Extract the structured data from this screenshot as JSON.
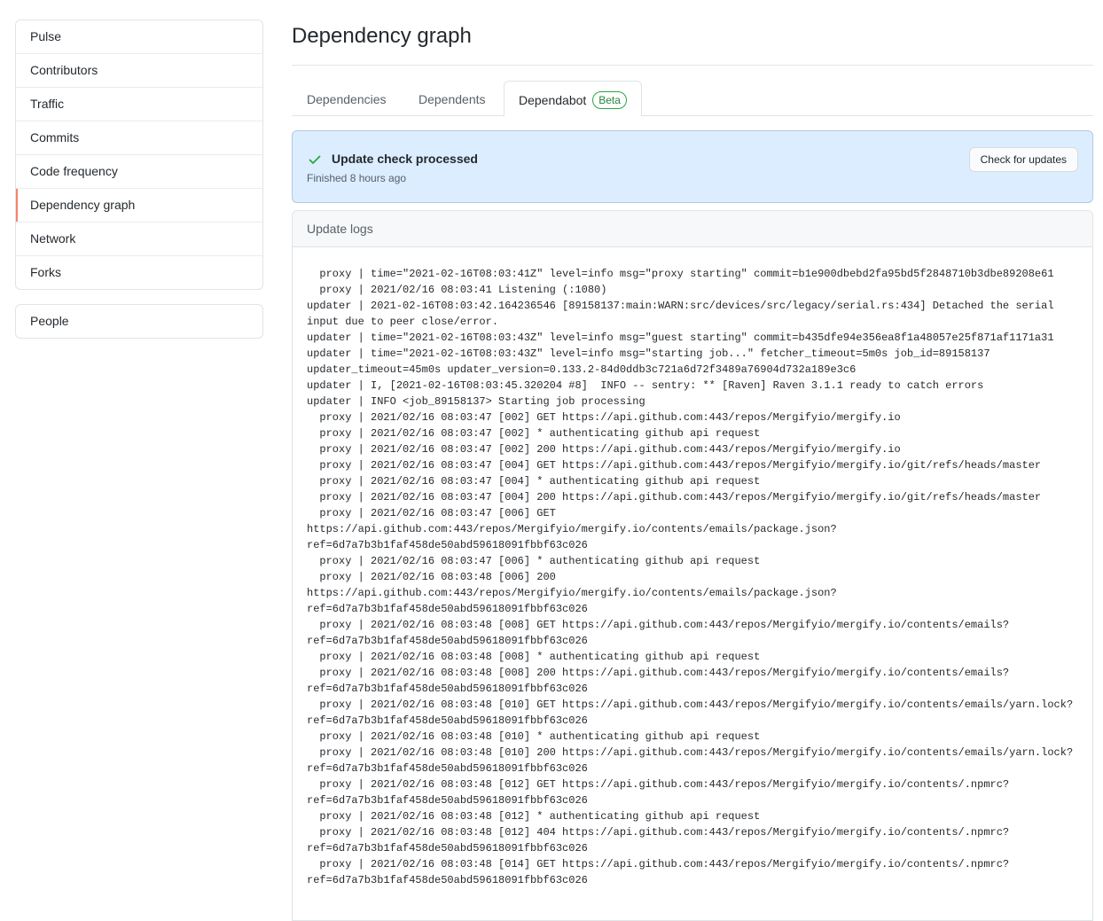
{
  "sidebar": {
    "items": [
      {
        "label": "Pulse"
      },
      {
        "label": "Contributors"
      },
      {
        "label": "Traffic"
      },
      {
        "label": "Commits"
      },
      {
        "label": "Code frequency"
      },
      {
        "label": "Dependency graph"
      },
      {
        "label": "Network"
      },
      {
        "label": "Forks"
      }
    ],
    "secondary": [
      {
        "label": "People"
      }
    ],
    "selected_index": 5,
    "selected_color": "#f9826c"
  },
  "header": {
    "title": "Dependency graph"
  },
  "tabs": [
    {
      "label": "Dependencies"
    },
    {
      "label": "Dependents"
    },
    {
      "label": "Dependabot",
      "badge": "Beta",
      "active": true
    }
  ],
  "flash": {
    "icon": "check-icon",
    "title": "Update check processed",
    "subtitle": "Finished 8 hours ago",
    "button_label": "Check for updates",
    "background": "#dbedff",
    "check_color": "#28a745"
  },
  "logs": {
    "header": "Update logs",
    "lines": [
      "  proxy | time=\"2021-02-16T08:03:41Z\" level=info msg=\"proxy starting\" commit=b1e900dbebd2fa95bd5f2848710b3dbe89208e61",
      "  proxy | 2021/02/16 08:03:41 Listening (:1080)",
      "updater | 2021-02-16T08:03:42.164236546 [89158137:main:WARN:src/devices/src/legacy/serial.rs:434] Detached the serial",
      "input due to peer close/error.",
      "updater | time=\"2021-02-16T08:03:43Z\" level=info msg=\"guest starting\" commit=b435dfe94e356ea8f1a48057e25f871af1171a31",
      "updater | time=\"2021-02-16T08:03:43Z\" level=info msg=\"starting job...\" fetcher_timeout=5m0s job_id=89158137",
      "updater_timeout=45m0s updater_version=0.133.2-84d0ddb3c721a6d72f3489a76904d732a189e3c6",
      "updater | I, [2021-02-16T08:03:45.320204 #8]  INFO -- sentry: ** [Raven] Raven 3.1.1 ready to catch errors",
      "updater | INFO <job_89158137> Starting job processing",
      "  proxy | 2021/02/16 08:03:47 [002] GET https://api.github.com:443/repos/Mergifyio/mergify.io",
      "  proxy | 2021/02/16 08:03:47 [002] * authenticating github api request",
      "  proxy | 2021/02/16 08:03:47 [002] 200 https://api.github.com:443/repos/Mergifyio/mergify.io",
      "  proxy | 2021/02/16 08:03:47 [004] GET https://api.github.com:443/repos/Mergifyio/mergify.io/git/refs/heads/master",
      "  proxy | 2021/02/16 08:03:47 [004] * authenticating github api request",
      "  proxy | 2021/02/16 08:03:47 [004] 200 https://api.github.com:443/repos/Mergifyio/mergify.io/git/refs/heads/master",
      "  proxy | 2021/02/16 08:03:47 [006] GET",
      "https://api.github.com:443/repos/Mergifyio/mergify.io/contents/emails/package.json?",
      "ref=6d7a7b3b1faf458de50abd59618091fbbf63c026",
      "  proxy | 2021/02/16 08:03:47 [006] * authenticating github api request",
      "  proxy | 2021/02/16 08:03:48 [006] 200",
      "https://api.github.com:443/repos/Mergifyio/mergify.io/contents/emails/package.json?",
      "ref=6d7a7b3b1faf458de50abd59618091fbbf63c026",
      "  proxy | 2021/02/16 08:03:48 [008] GET https://api.github.com:443/repos/Mergifyio/mergify.io/contents/emails?",
      "ref=6d7a7b3b1faf458de50abd59618091fbbf63c026",
      "  proxy | 2021/02/16 08:03:48 [008] * authenticating github api request",
      "  proxy | 2021/02/16 08:03:48 [008] 200 https://api.github.com:443/repos/Mergifyio/mergify.io/contents/emails?",
      "ref=6d7a7b3b1faf458de50abd59618091fbbf63c026",
      "  proxy | 2021/02/16 08:03:48 [010] GET https://api.github.com:443/repos/Mergifyio/mergify.io/contents/emails/yarn.lock?",
      "ref=6d7a7b3b1faf458de50abd59618091fbbf63c026",
      "  proxy | 2021/02/16 08:03:48 [010] * authenticating github api request",
      "  proxy | 2021/02/16 08:03:48 [010] 200 https://api.github.com:443/repos/Mergifyio/mergify.io/contents/emails/yarn.lock?",
      "ref=6d7a7b3b1faf458de50abd59618091fbbf63c026",
      "  proxy | 2021/02/16 08:03:48 [012] GET https://api.github.com:443/repos/Mergifyio/mergify.io/contents/.npmrc?",
      "ref=6d7a7b3b1faf458de50abd59618091fbbf63c026",
      "  proxy | 2021/02/16 08:03:48 [012] * authenticating github api request",
      "  proxy | 2021/02/16 08:03:48 [012] 404 https://api.github.com:443/repos/Mergifyio/mergify.io/contents/.npmrc?",
      "ref=6d7a7b3b1faf458de50abd59618091fbbf63c026",
      "  proxy | 2021/02/16 08:03:48 [014] GET https://api.github.com:443/repos/Mergifyio/mergify.io/contents/.npmrc?",
      "ref=6d7a7b3b1faf458de50abd59618091fbbf63c026"
    ]
  }
}
